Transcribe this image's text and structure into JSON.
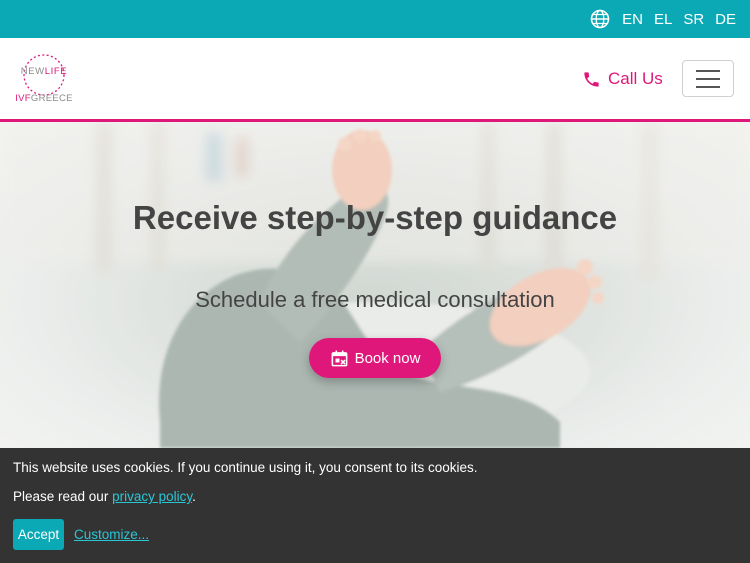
{
  "topbar": {
    "icon": "globe-icon",
    "languages": [
      "EN",
      "EL",
      "SR",
      "DE"
    ],
    "background_color": "#0aa9b5"
  },
  "header": {
    "logo": {
      "line1_a": "NEW",
      "line1_b": "LIFE",
      "line2_a": "IVF",
      "line2_b": "GREECE"
    },
    "call": {
      "icon": "phone-icon",
      "label": "Call Us"
    },
    "menu_icon": "hamburger-menu-icon",
    "accent_color": "#e0177a"
  },
  "hero": {
    "title": "Receive step-by-step guidance",
    "subtitle": "Schedule a free medical consultation",
    "button": {
      "icon": "calendar-icon",
      "label": "Book now"
    }
  },
  "cookie": {
    "text1": "This website uses cookies. If you continue using it, you consent to its cookies.",
    "text2_prefix": "Please read our ",
    "policy_link": "privacy policy",
    "text2_suffix": ".",
    "accept_label": "Accept",
    "customize_label": "Customize..."
  }
}
